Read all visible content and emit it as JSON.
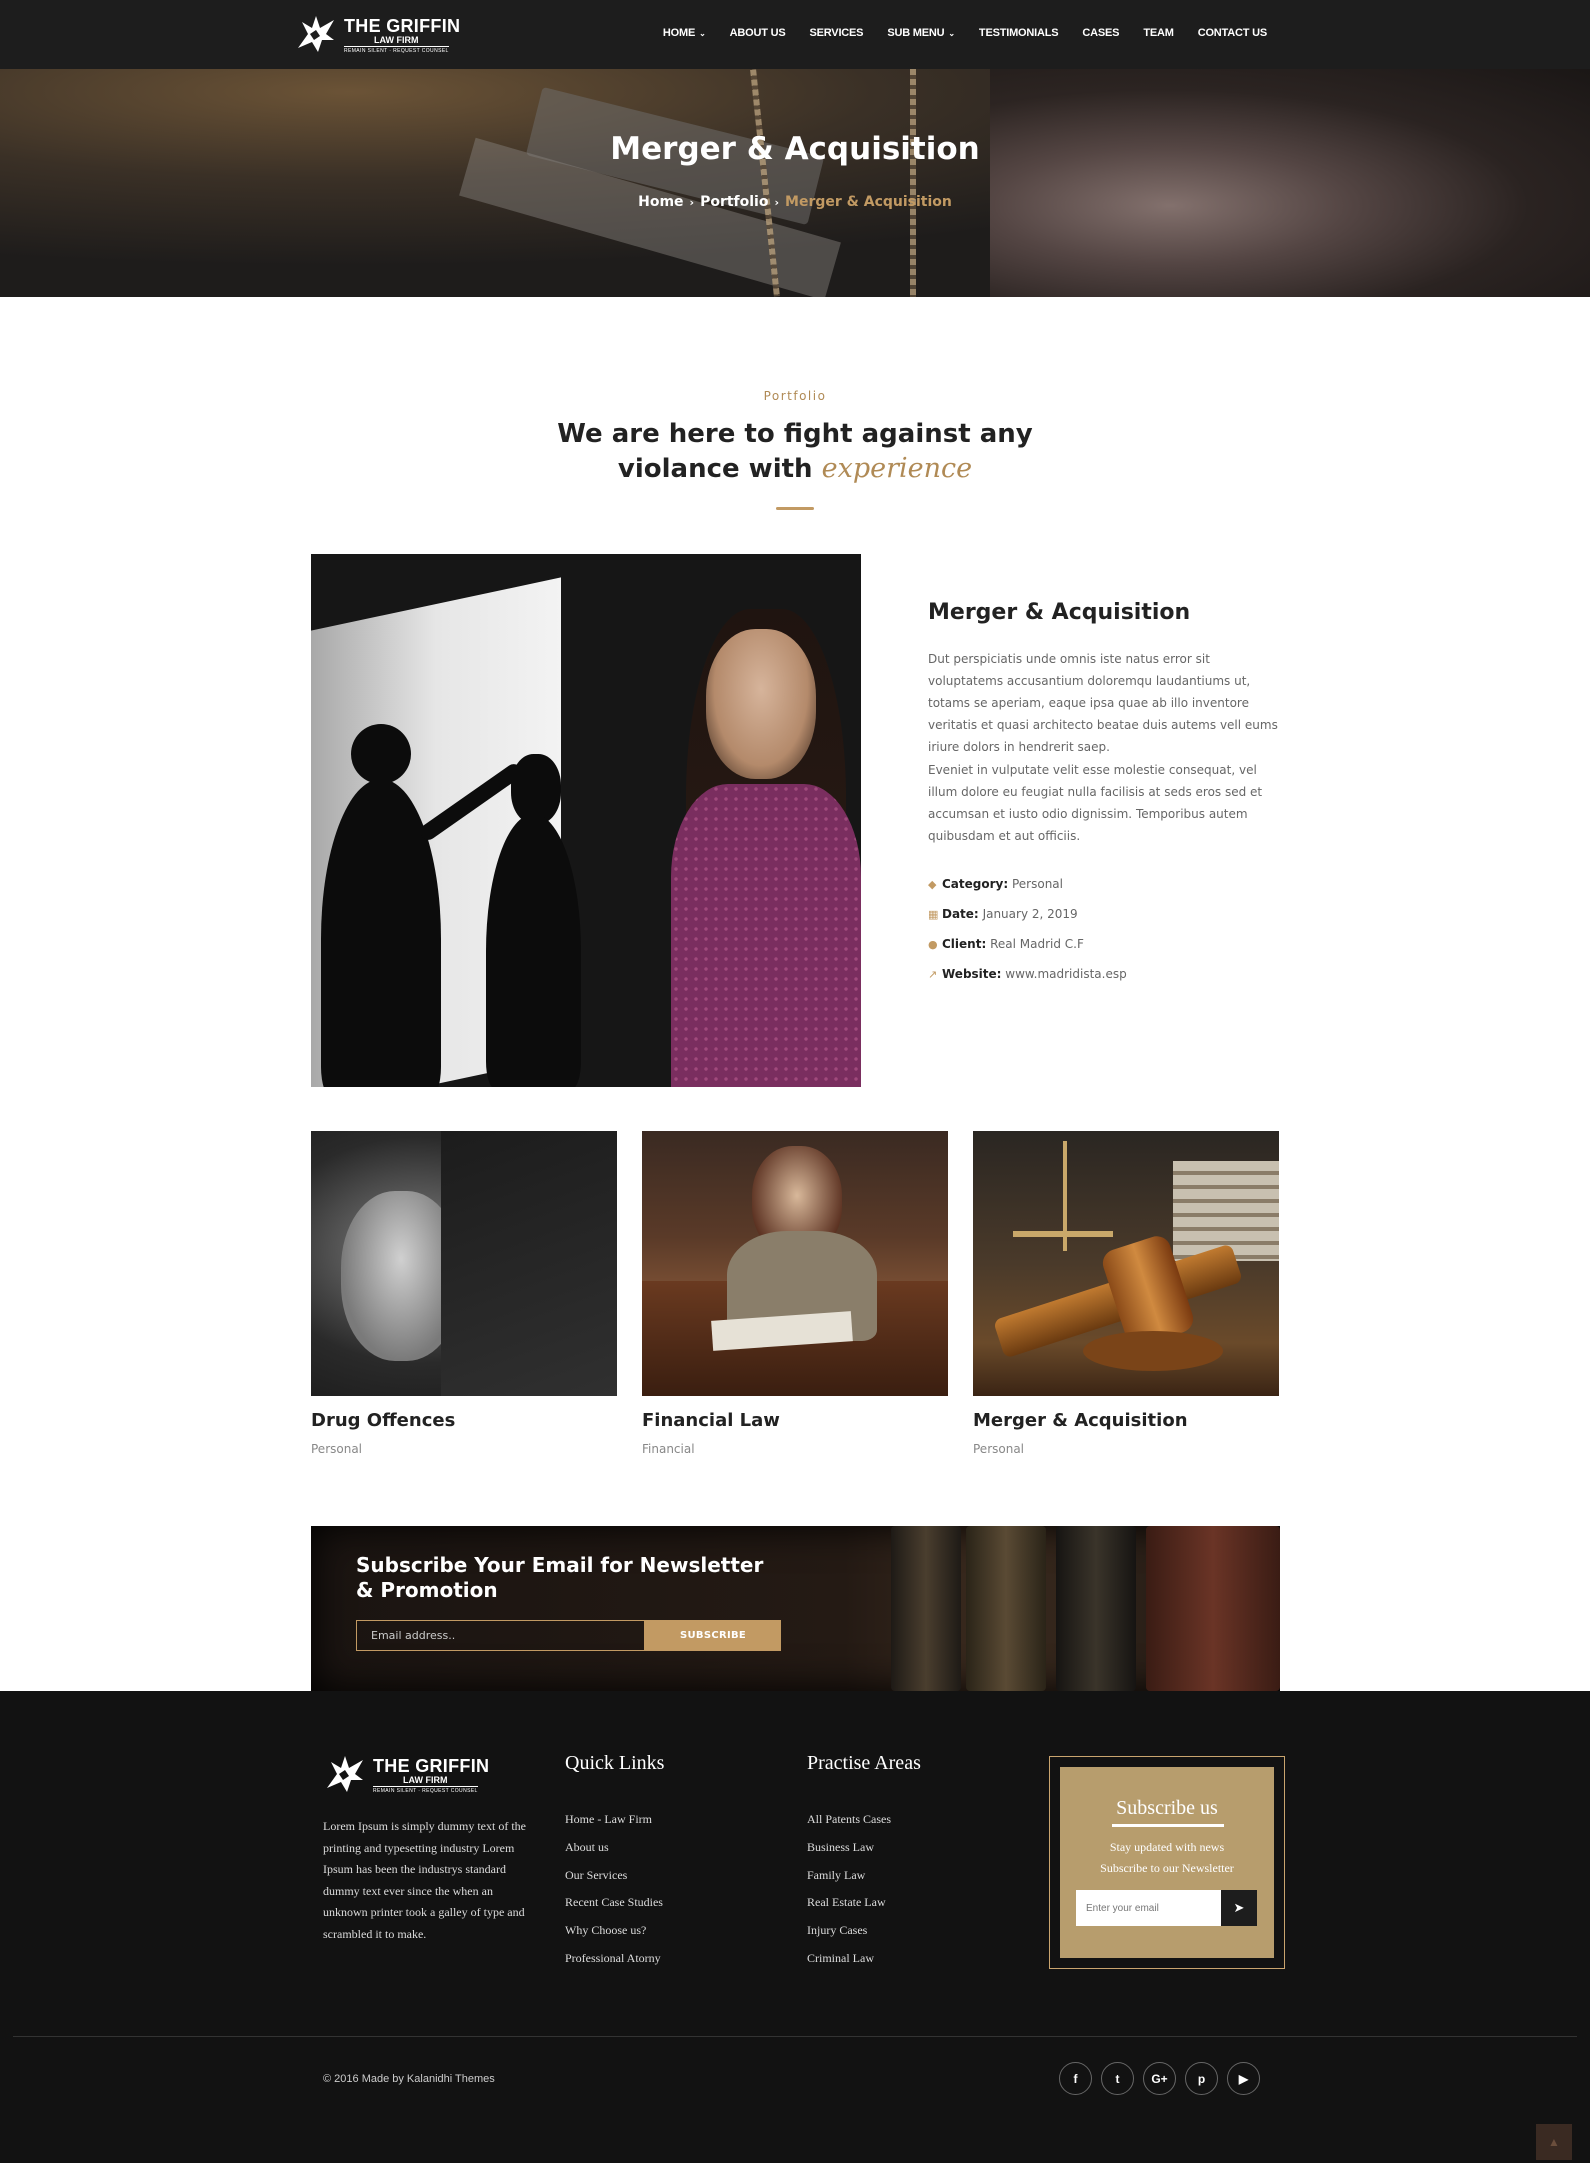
{
  "brand": {
    "title": "THE GRIFFIN",
    "subtitle": "LAW FIRM",
    "tagline": "REMAIN SILENT · REQUEST COUNSEL"
  },
  "nav": {
    "items": [
      {
        "label": "HOME",
        "dropdown": true
      },
      {
        "label": "ABOUT US",
        "dropdown": false
      },
      {
        "label": "SERVICES",
        "dropdown": false
      },
      {
        "label": "SUB MENU",
        "dropdown": true
      },
      {
        "label": "TESTIMONIALS",
        "dropdown": false
      },
      {
        "label": "CASES",
        "dropdown": false
      },
      {
        "label": "TEAM",
        "dropdown": false
      },
      {
        "label": "CONTACT US",
        "dropdown": false
      }
    ]
  },
  "hero": {
    "title": "Merger & Acquisition",
    "breadcrumbs": [
      "Home",
      "Portfolio",
      "Merger & Acquisition"
    ]
  },
  "section": {
    "kicker": "Portfolio",
    "headline_line1": "We are here to fight against any",
    "headline_line2": "violance with",
    "headline_accent": "experience"
  },
  "detail": {
    "title": "Merger & Acquisition",
    "para1": "Dut perspiciatis unde omnis iste natus error sit voluptatems accusantium doloremqu laudantiums ut, totams se aperiam, eaque ipsa quae ab illo inventore veritatis et quasi architecto beatae duis autems vell eums iriure dolors in hendrerit saep.",
    "para2": "Eveniet in vulputate velit esse molestie consequat, vel illum dolore eu feugiat nulla facilisis at seds eros sed et accumsan et iusto odio dignissim. Temporibus autem quibusdam et aut officiis.",
    "meta": [
      {
        "icon": "tag-icon",
        "label": "Category:",
        "value": "Personal"
      },
      {
        "icon": "calendar-icon",
        "label": "Date:",
        "value": "January 2, 2019"
      },
      {
        "icon": "user-icon",
        "label": "Client:",
        "value": "Real Madrid C.F"
      },
      {
        "icon": "external-link-icon",
        "label": "Website:",
        "value": "www.madridista.esp"
      }
    ]
  },
  "cards": [
    {
      "title": "Drug Offences",
      "category": "Personal"
    },
    {
      "title": "Financial Law",
      "category": "Financial"
    },
    {
      "title": "Merger & Acquisition",
      "category": "Personal"
    }
  ],
  "newsletter": {
    "title_line1": "Subscribe Your Email for Newsletter",
    "title_line2": "& Promotion",
    "placeholder": "Email address..",
    "button": "SUBSCRIBE"
  },
  "footer": {
    "about": "Lorem Ipsum is simply dummy text of the printing and typesetting industry Lorem Ipsum has been the industrys standard dummy text ever since the when an unknown printer took a galley of type and scrambled it to make.",
    "quick_links_title": "Quick Links",
    "quick_links": [
      "Home - Law Firm",
      "About us",
      "Our Services",
      "Recent Case Studies",
      "Why Choose us?",
      "Professional Atorny"
    ],
    "practice_title": "Practise Areas",
    "practice_areas": [
      "All Patents Cases",
      "Business Law",
      "Family Law",
      "Real Estate Law",
      "Injury Cases",
      "Criminal Law"
    ],
    "subscribe_title": "Subscribe us",
    "subscribe_text_1": "Stay updated with news",
    "subscribe_text_2": "Subscribe to our Newsletter",
    "subscribe_placeholder": "Enter your email",
    "copyright": "© 2016 Made by Kalanidhi Themes",
    "social": [
      {
        "icon": "facebook-icon",
        "glyph": "f"
      },
      {
        "icon": "twitter-icon",
        "glyph": "t"
      },
      {
        "icon": "google-plus-icon",
        "glyph": "G+"
      },
      {
        "icon": "pinterest-icon",
        "glyph": "p"
      },
      {
        "icon": "youtube-icon",
        "glyph": "▶"
      }
    ]
  },
  "colors": {
    "accent": "#c29a63",
    "header_bg": "#1d1d1d",
    "footer_bg": "#121212",
    "subscribe_box_bg": "#b79d6d"
  }
}
